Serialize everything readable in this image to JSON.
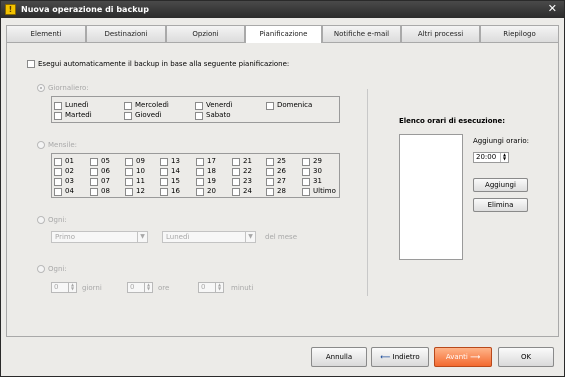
{
  "window": {
    "title": "Nuova operazione di backup",
    "app_icon": "!",
    "close_glyph": "✕"
  },
  "tabs": [
    {
      "label": "Elementi"
    },
    {
      "label": "Destinazioni"
    },
    {
      "label": "Opzioni"
    },
    {
      "label": "Pianificazione"
    },
    {
      "label": "Notifiche e-mail"
    },
    {
      "label": "Altri processi"
    },
    {
      "label": "Riepilogo"
    }
  ],
  "active_tab": "Pianificazione",
  "schedule": {
    "auto_label": "Esegui automaticamente il backup in base alla seguente pianificazione:",
    "daily": {
      "label": "Giornaliero:",
      "days": [
        "Lunedì",
        "Mercoledì",
        "Venerdì",
        "Domenica",
        "Martedì",
        "Giovedì",
        "Sabato"
      ]
    },
    "monthly": {
      "label": "Mensile:",
      "days": [
        "01",
        "05",
        "09",
        "13",
        "17",
        "21",
        "25",
        "29",
        "02",
        "06",
        "10",
        "14",
        "18",
        "22",
        "26",
        "30",
        "03",
        "07",
        "11",
        "15",
        "19",
        "23",
        "27",
        "31",
        "04",
        "08",
        "12",
        "16",
        "20",
        "24",
        "28",
        "Ultimo"
      ]
    },
    "every": {
      "label": "Ogni:",
      "ordinal": "Primo",
      "weekday": "Lunedì",
      "suffix": "del mese"
    },
    "interval": {
      "label": "Ogni:",
      "days": "0",
      "days_label": "giorni",
      "hours": "0",
      "hours_label": "ore",
      "minutes": "0",
      "minutes_label": "minuti"
    }
  },
  "times": {
    "header": "Elenco orari di esecuzione:",
    "add_label": "Aggiungi orario:",
    "time": "20:00",
    "add_button": "Aggiungi",
    "remove_button": "Elimina"
  },
  "footer": {
    "cancel": "Annulla",
    "back": "Indietro",
    "next": "Avanti",
    "ok": "OK",
    "back_arrow": "⟵",
    "next_arrow": "⟶"
  }
}
